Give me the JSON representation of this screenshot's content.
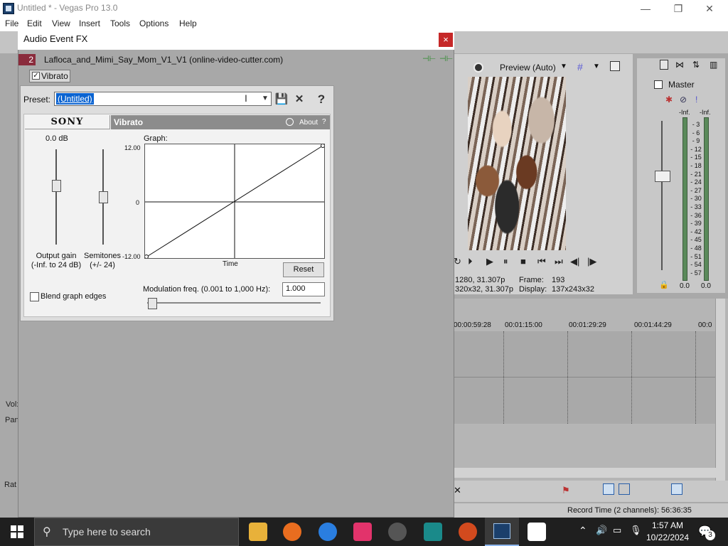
{
  "window": {
    "title": "Untitled * - Vegas Pro 13.0",
    "controls": {
      "minimize": "—",
      "maximize": "❐",
      "close": "✕"
    }
  },
  "menu": {
    "items": [
      "File",
      "Edit",
      "View",
      "Insert",
      "Tools",
      "Options",
      "Help"
    ]
  },
  "preview": {
    "mode_label": "Preview (Auto)",
    "info_line1_left": "1280, 31.307p",
    "info_line2_left": "320x32, 31.307p",
    "frame_label": "Frame:",
    "frame_value": "193",
    "display_label": "Display:",
    "display_value": "137x243x32"
  },
  "master": {
    "label": "Master",
    "inf_left": "-Inf.",
    "inf_right": "-Inf.",
    "scale": [
      "3",
      "6",
      "9",
      "12",
      "15",
      "18",
      "21",
      "24",
      "27",
      "30",
      "33",
      "36",
      "39",
      "42",
      "45",
      "48",
      "51",
      "54",
      "57"
    ],
    "value_left": "0.0",
    "value_right": "0.0"
  },
  "timeline": {
    "ruler": [
      "00:00:59:28",
      "00:01:15:00",
      "00:01:29:29",
      "00:01:44:29",
      "00:0"
    ]
  },
  "status": {
    "record_time": "Record Time (2 channels): 56:36:35"
  },
  "left_strip": {
    "vol": "Vol:",
    "pan": "Pan:",
    "rate": "Rat"
  },
  "dialog": {
    "title": "Audio Event FX",
    "close": "×",
    "track_number": "2",
    "event_name": "Lafloca_and_Mimi_Say_Mom_V1_V1 (online-video-cutter.com)",
    "plugin_tab": "Vibrato",
    "preset_label": "Preset:",
    "preset_value": "(Untitled)",
    "help_glyph": "?",
    "brand": "SONY",
    "plugin_name": "Vibrato",
    "about": "About",
    "about_help": "?",
    "output_gain_value": "0.0 dB",
    "output_gain_label": "Output gain",
    "output_gain_range": "(-Inf. to 24 dB)",
    "semitones_label": "Semitones",
    "semitones_range": "(+/- 24)",
    "graph_label": "Graph:",
    "graph_y_max": "12.00",
    "graph_y_mid": "0",
    "graph_y_min": "-12.00",
    "graph_x_label": "Time",
    "reset": "Reset",
    "blend_label": "Blend graph edges",
    "modulation_label": "Modulation freq. (0.001 to 1,000 Hz):",
    "modulation_value": "1.000"
  },
  "taskbar": {
    "search_placeholder": "Type here to search",
    "time": "1:57 AM",
    "date": "10/22/2024",
    "notification_count": "3"
  },
  "colors": {
    "accent_selection": "#0a63d1",
    "track_badge": "#8a2b3c",
    "close_red": "#c62828"
  }
}
